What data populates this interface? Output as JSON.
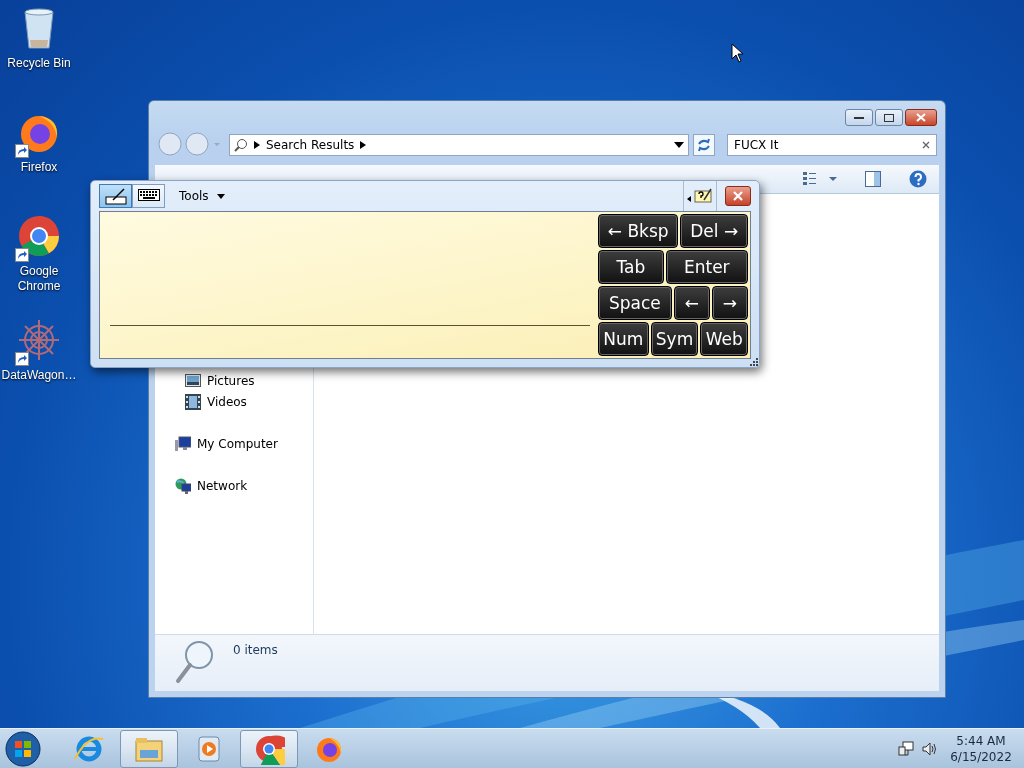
{
  "desktop_icons": [
    {
      "label": "Recycle Bin",
      "kind": "recycle",
      "shortcut": false
    },
    {
      "label": "Firefox",
      "kind": "firefox",
      "shortcut": true
    },
    {
      "label": "Google Chrome",
      "kind": "chrome",
      "shortcut": true
    },
    {
      "label": "DataWagon…",
      "kind": "datawagon",
      "shortcut": true
    }
  ],
  "explorer": {
    "address": "Search Results",
    "search": {
      "value": "FUCX It"
    },
    "nav_items": [
      {
        "label": "Pictures",
        "kind": "pictures"
      },
      {
        "label": "Videos",
        "kind": "videos"
      },
      {
        "label": "My Computer",
        "kind": "computer"
      },
      {
        "label": "Network",
        "kind": "network"
      }
    ],
    "status": "0 items"
  },
  "input_panel": {
    "modes": [
      {
        "kind": "handwriting",
        "selected": true
      },
      {
        "kind": "keyboard",
        "selected": false
      }
    ],
    "menu": "Tools",
    "keys": [
      [
        "← Bksp",
        "Del →"
      ],
      [
        "Tab",
        "Enter"
      ],
      [
        "Space",
        "←",
        "→"
      ],
      [
        "Num",
        "Sym",
        "Web"
      ]
    ]
  },
  "taskbar": {
    "items": [
      {
        "kind": "ie",
        "highlighted": false
      },
      {
        "kind": "explorer",
        "highlighted": true
      },
      {
        "kind": "media",
        "highlighted": false
      },
      {
        "kind": "chrome",
        "highlighted": true
      },
      {
        "kind": "firefox",
        "highlighted": false
      }
    ],
    "time": "5:44 AM",
    "date": "6/15/2022"
  }
}
